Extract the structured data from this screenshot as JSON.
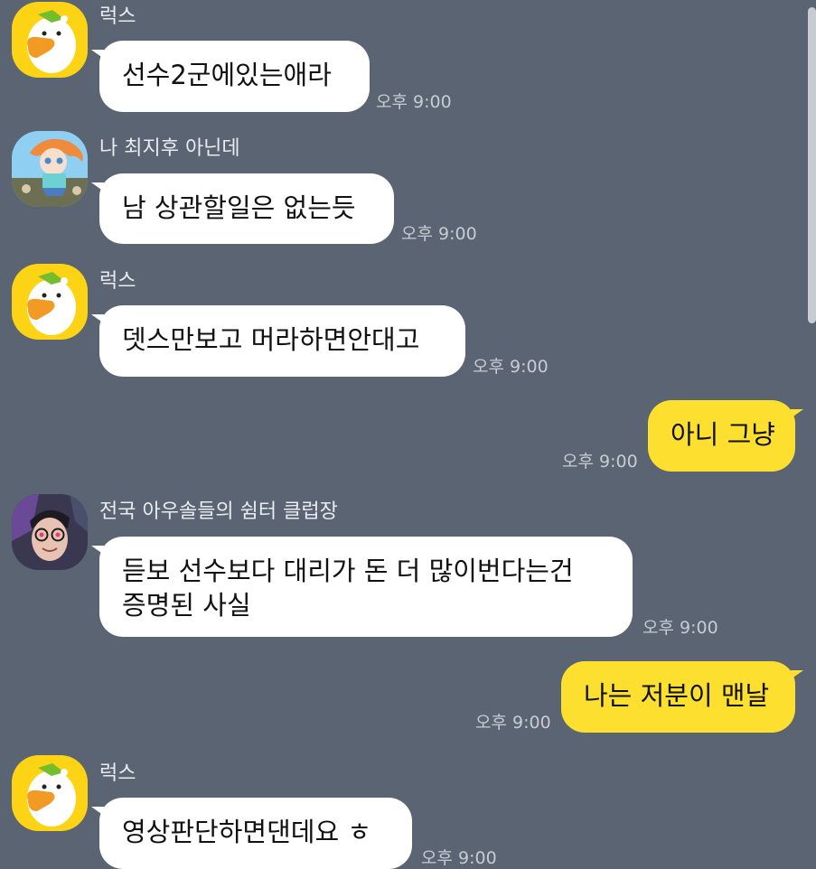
{
  "messages": [
    {
      "type": "in",
      "sender": "럭스",
      "text": "선수2군에있는애라",
      "time": "오후 9:00",
      "avatar": "duck-avatar"
    },
    {
      "type": "in",
      "sender": "나 최지후 아닌데",
      "text": "남 상관할일은 없는듯",
      "time": "오후 9:00",
      "avatar": "girl-cartoon-avatar"
    },
    {
      "type": "in",
      "sender": "럭스",
      "text": "뎃스만보고 머라하면안대고",
      "time": "오후 9:00",
      "avatar": "duck-avatar"
    },
    {
      "type": "out",
      "text": "아니 그냥",
      "time": "오후 9:00"
    },
    {
      "type": "in",
      "sender": "전국 아우솔들의 쉼터 클럽장",
      "text_line1": "듣보 선수보다 대리가 돈 더 많이번다는건",
      "text_line2": "증명된 사실",
      "time": "오후 9:00",
      "avatar": "man-glasses-avatar"
    },
    {
      "type": "out",
      "text": "나는 저분이 맨날",
      "time": "오후 9:00"
    },
    {
      "type": "in",
      "sender": "럭스",
      "text": "영상판단하면댄데요 ㅎ",
      "time": "오후 9:00",
      "avatar": "duck-avatar"
    }
  ],
  "colors": {
    "background": "#5a6472",
    "incoming_bubble": "#ffffff",
    "outgoing_bubble": "#fde02f",
    "timestamp": "#c7ccd4",
    "sender_name": "#e9ecf1"
  }
}
